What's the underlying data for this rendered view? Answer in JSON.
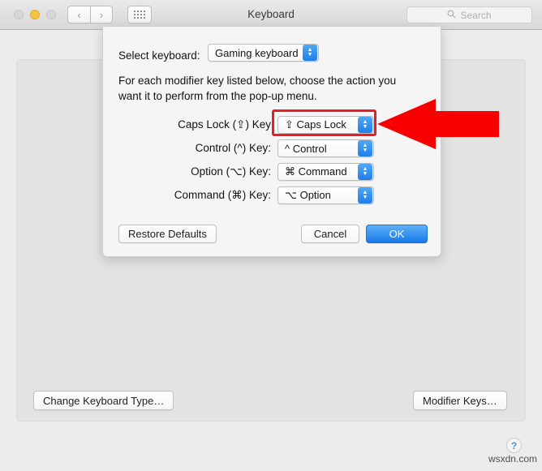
{
  "window": {
    "title": "Keyboard",
    "traffic_lights": [
      {
        "name": "close",
        "color": "#d8d8d8"
      },
      {
        "name": "minimize",
        "color": "#f7c342"
      },
      {
        "name": "maximize",
        "color": "#d8d8d8"
      }
    ],
    "nav": {
      "back": "‹",
      "forward": "›"
    },
    "grid_button": "show-all-icon"
  },
  "search": {
    "placeholder": "Search",
    "icon": "search-icon"
  },
  "sheet": {
    "select_keyboard_label": "Select keyboard:",
    "keyboard_popup_value": "Gaming keyboard",
    "instructions": "For each modifier key listed below, choose the action you want it to perform from the pop-up menu.",
    "rows": [
      {
        "label": "Caps Lock (⇪) Key",
        "value": "⇪ Caps Lock",
        "highlighted": true
      },
      {
        "label": "Control (^) Key:",
        "value": "^ Control",
        "highlighted": false
      },
      {
        "label": "Option (⌥) Key:",
        "value": "⌘ Command",
        "highlighted": false
      },
      {
        "label": "Command (⌘) Key:",
        "value": "⌥ Option",
        "highlighted": false
      }
    ],
    "restore_defaults_label": "Restore Defaults",
    "cancel_label": "Cancel",
    "ok_label": "OK"
  },
  "main": {
    "change_keyboard_type_label": "Change Keyboard Type…",
    "modifier_keys_label": "Modifier Keys…",
    "help_label": "?"
  },
  "annotation": {
    "arrow_color": "#f90000",
    "highlight_color": "#ec1c24",
    "target": "caps-lock-popup"
  },
  "watermark": "wsxdn.com"
}
